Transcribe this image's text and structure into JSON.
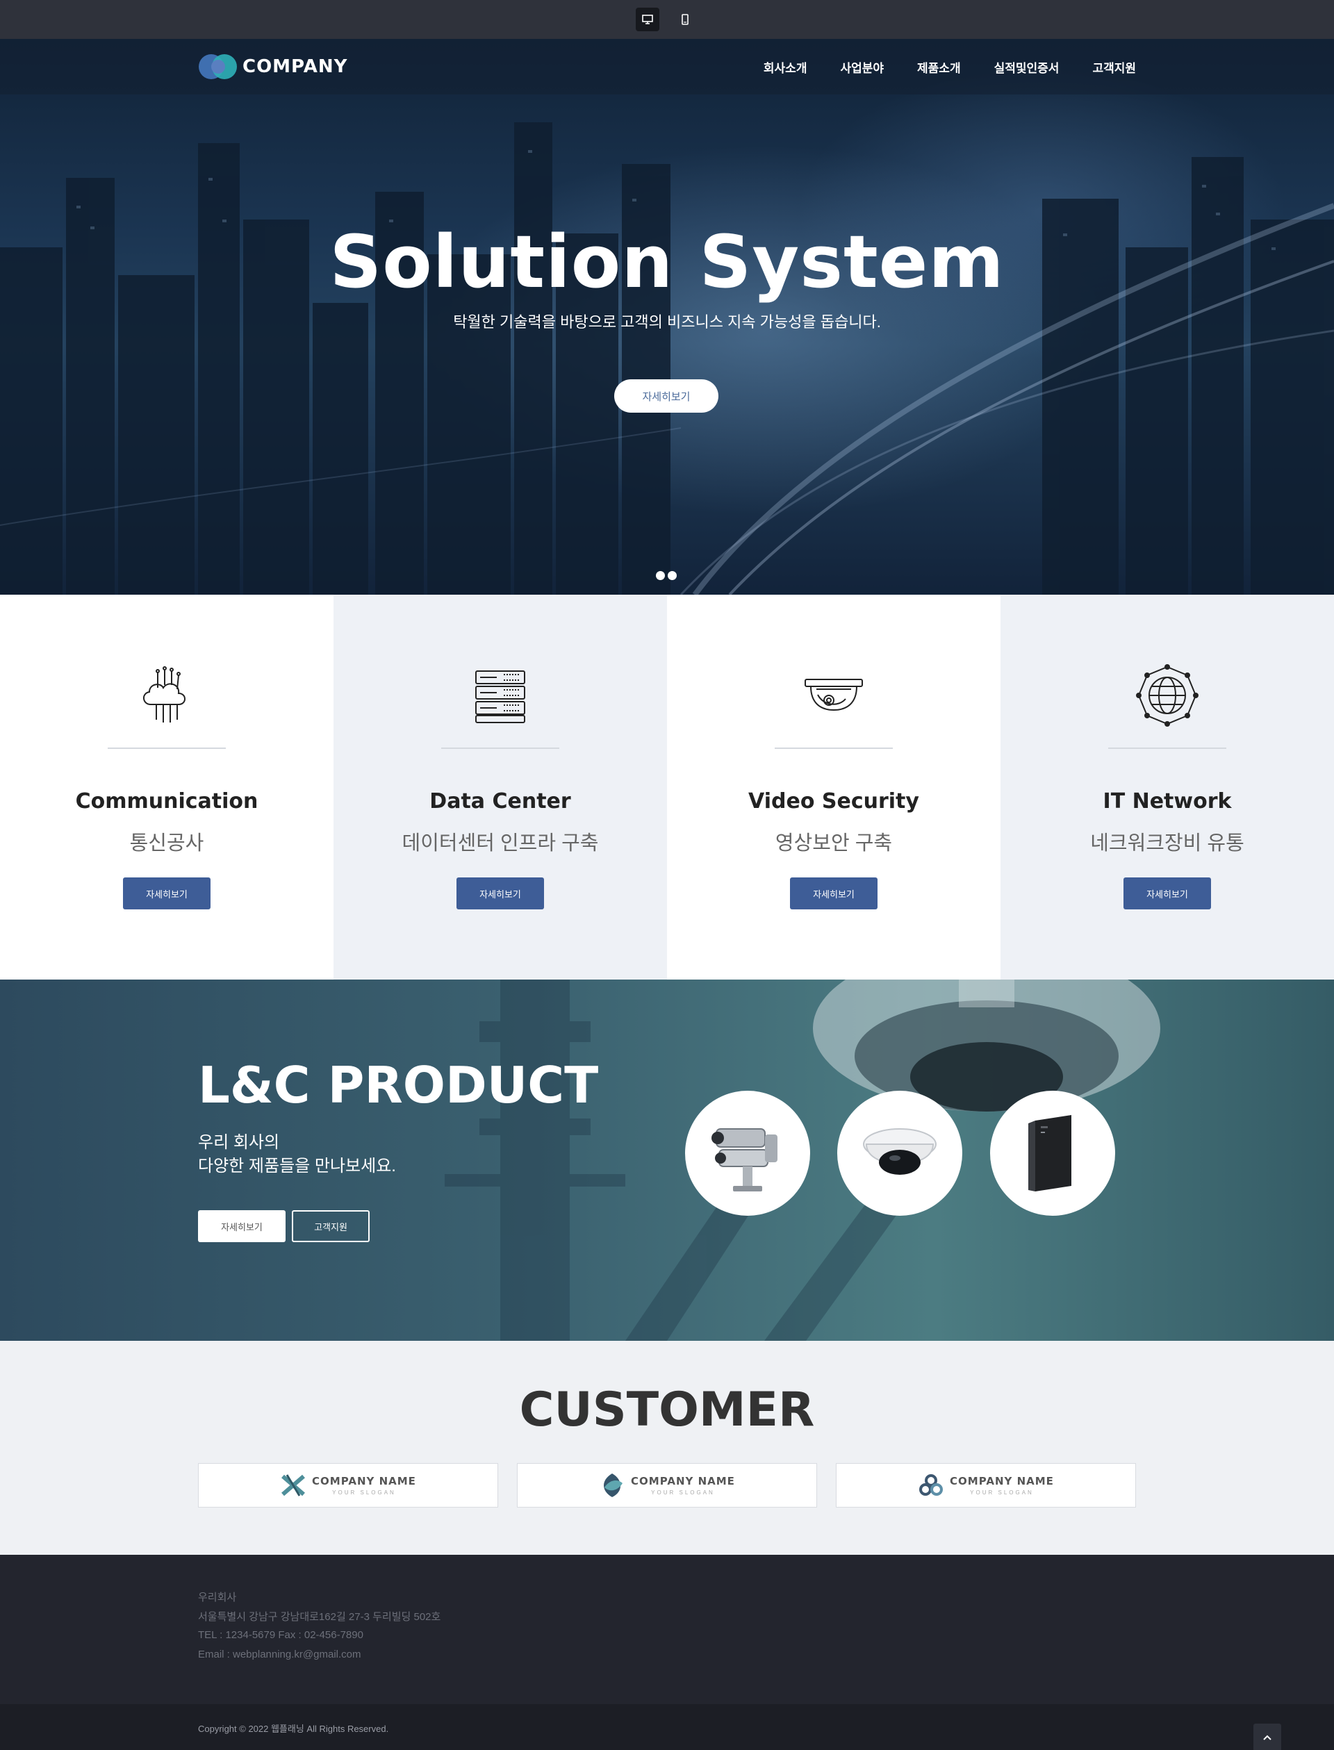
{
  "devbar": {
    "desktop_icon": "monitor-icon",
    "mobile_icon": "mobile-icon"
  },
  "header": {
    "logo_text": "COMPANY",
    "nav": [
      "회사소개",
      "사업분야",
      "제품소개",
      "실적및인증서",
      "고객지원"
    ]
  },
  "hero": {
    "title": "Solution System",
    "subtitle": "탁월한 기술력을 바탕으로 고객의 비즈니스 지속 가능성을 돕습니다.",
    "button": "자세히보기"
  },
  "services": [
    {
      "icon": "cloud-circuit-icon",
      "title": "Communication",
      "subtitle": "통신공사",
      "button": "자세히보기"
    },
    {
      "icon": "server-rack-icon",
      "title": "Data Center",
      "subtitle": "데이터센터 인프라 구축",
      "button": "자세히보기"
    },
    {
      "icon": "dome-camera-icon",
      "title": "Video Security",
      "subtitle": "영상보안 구축",
      "button": "자세히보기"
    },
    {
      "icon": "globe-network-icon",
      "title": "IT Network",
      "subtitle": "네크워크장비 유통",
      "button": "자세히보기"
    }
  ],
  "product": {
    "title": "L&C PRODUCT",
    "line1": "우리 회사의",
    "line2": "다양한 제품들을 만나보세요.",
    "button_more": "자세히보기",
    "button_support": "고객지원"
  },
  "customer": {
    "title": "CUSTOMER",
    "logos": [
      {
        "name": "COMPANY NAME",
        "slogan": "YOUR SLOGAN"
      },
      {
        "name": "COMPANY NAME",
        "slogan": "YOUR SLOGAN"
      },
      {
        "name": "COMPANY NAME",
        "slogan": "YOUR SLOGAN"
      }
    ]
  },
  "footer": {
    "company": "우리회사",
    "address": "서울특별시 강남구 강남대로162길 27-3 두리빌딩 502호",
    "tel": "TEL : 1234-5679 Fax : 02-456-7890",
    "email": "Email : webplanning.kr@gmail.com",
    "copyright": "Copyright © 2022 웹플래닝 All Rights Reserved."
  },
  "colors": {
    "accent": "#3e5d97",
    "footer_bg": "#23252e",
    "devbar_bg": "#2f323b"
  }
}
